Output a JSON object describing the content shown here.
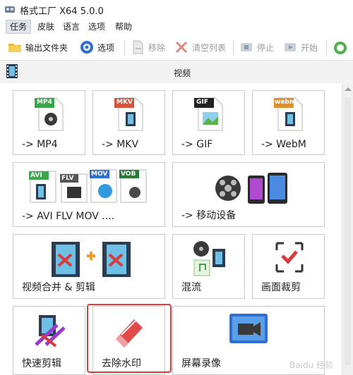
{
  "window": {
    "title": "格式工厂 X64 5.0.0"
  },
  "menu": [
    "任务",
    "皮肤",
    "语言",
    "选项",
    "帮助"
  ],
  "toolbar": {
    "output_folder": "输出文件夹",
    "options": "选项",
    "remove": "移除",
    "clear_list": "清空列表",
    "stop": "停止",
    "start": "开始"
  },
  "section": {
    "title": "视频"
  },
  "tiles": {
    "mp4": {
      "label": "-> MP4",
      "badge": "MP4"
    },
    "mkv": {
      "label": "-> MKV",
      "badge": "MKV"
    },
    "gif": {
      "label": "-> GIF",
      "badge": "GIF"
    },
    "webm": {
      "label": "-> WebM",
      "badge": "webm"
    },
    "multi": {
      "label": "-> AVI FLV MOV ....",
      "badges": [
        "AVI",
        "FLV",
        "MOV",
        "VOB"
      ]
    },
    "mobile": {
      "label": "-> 移动设备"
    },
    "merge": {
      "label": "视频合并 & 剪辑"
    },
    "mux": {
      "label": "混流"
    },
    "crop": {
      "label": "画面裁剪"
    },
    "quick_cut": {
      "label": "快速剪辑"
    },
    "watermark_remove": {
      "label": "去除水印"
    },
    "screen_record": {
      "label": "屏幕录像"
    }
  },
  "watermark_text": "Baidu 经验",
  "colors": {
    "highlight": "#e03a3a",
    "accent_green": "#3aa84a",
    "accent_blue": "#2f6fd0"
  }
}
